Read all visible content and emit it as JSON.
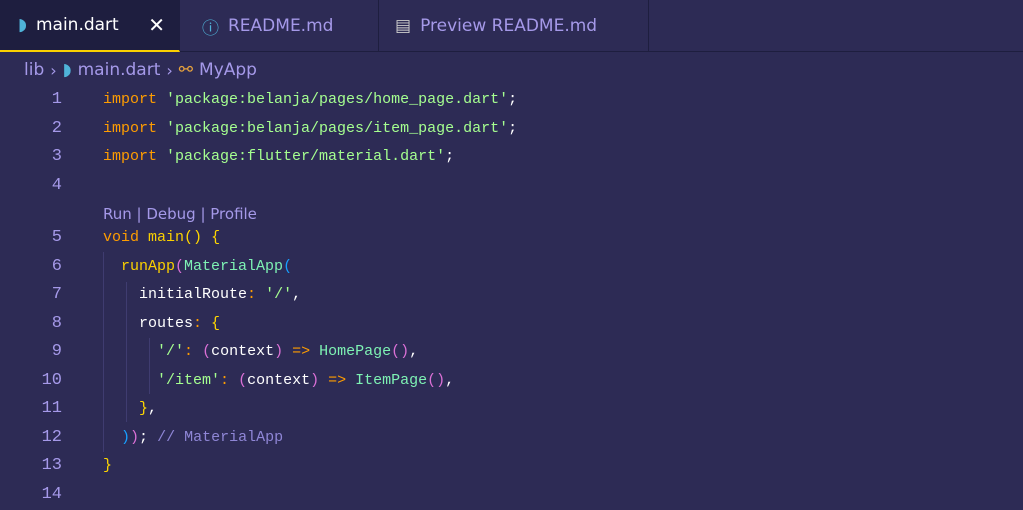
{
  "tabs": [
    {
      "label": "main.dart",
      "icon": "dart-icon",
      "active": true
    },
    {
      "label": "README.md",
      "icon": "info-icon"
    },
    {
      "label": "Preview README.md",
      "icon": "preview-icon"
    }
  ],
  "close_label": "✕",
  "breadcrumb": {
    "items": [
      "lib",
      "main.dart",
      "MyApp"
    ]
  },
  "codelens": "Run | Debug | Profile",
  "lines": [
    {
      "n": "1",
      "t": [
        [
          "import",
          "kw"
        ],
        [
          " ",
          "tx"
        ],
        [
          "'package:belanja/pages/home_page.dart'",
          "str"
        ],
        [
          ";",
          "tx"
        ]
      ]
    },
    {
      "n": "2",
      "t": [
        [
          "import",
          "kw"
        ],
        [
          " ",
          "tx"
        ],
        [
          "'package:belanja/pages/item_page.dart'",
          "str"
        ],
        [
          ";",
          "tx"
        ]
      ]
    },
    {
      "n": "3",
      "t": [
        [
          "import",
          "kw"
        ],
        [
          " ",
          "tx"
        ],
        [
          "'package:flutter/material.dart'",
          "str"
        ],
        [
          ";",
          "tx"
        ]
      ]
    },
    {
      "n": "4",
      "t": []
    },
    {
      "n": "5",
      "t": [
        [
          "void",
          "kw"
        ],
        [
          " ",
          "tx"
        ],
        [
          "main",
          "fn"
        ],
        [
          "()",
          "p1"
        ],
        [
          " ",
          "tx"
        ],
        [
          "{",
          "p1"
        ]
      ]
    },
    {
      "n": "6",
      "t": [
        [
          "  ",
          "tx"
        ],
        [
          "runApp",
          "fn"
        ],
        [
          "(",
          "p2"
        ],
        [
          "MaterialApp",
          "cls"
        ],
        [
          "(",
          "p3"
        ]
      ]
    },
    {
      "n": "7",
      "t": [
        [
          "    initialRoute",
          "tx"
        ],
        [
          ":",
          "op"
        ],
        [
          " ",
          "tx"
        ],
        [
          "'/'",
          "str"
        ],
        [
          ",",
          "tx"
        ]
      ]
    },
    {
      "n": "8",
      "t": [
        [
          "    routes",
          "tx"
        ],
        [
          ":",
          "op"
        ],
        [
          " ",
          "tx"
        ],
        [
          "{",
          "p1"
        ]
      ]
    },
    {
      "n": "9",
      "t": [
        [
          "      ",
          "tx"
        ],
        [
          "'/'",
          "str"
        ],
        [
          ":",
          "op"
        ],
        [
          " ",
          "tx"
        ],
        [
          "(",
          "p2"
        ],
        [
          "context",
          "tx"
        ],
        [
          ")",
          "p2"
        ],
        [
          " ",
          "tx"
        ],
        [
          "=>",
          "op"
        ],
        [
          " ",
          "tx"
        ],
        [
          "HomePage",
          "cls"
        ],
        [
          "()",
          "p2"
        ],
        [
          ",",
          "tx"
        ]
      ]
    },
    {
      "n": "10",
      "t": [
        [
          "      ",
          "tx"
        ],
        [
          "'/item'",
          "str"
        ],
        [
          ":",
          "op"
        ],
        [
          " ",
          "tx"
        ],
        [
          "(",
          "p2"
        ],
        [
          "context",
          "tx"
        ],
        [
          ")",
          "p2"
        ],
        [
          " ",
          "tx"
        ],
        [
          "=>",
          "op"
        ],
        [
          " ",
          "tx"
        ],
        [
          "ItemPage",
          "cls"
        ],
        [
          "()",
          "p2"
        ],
        [
          ",",
          "tx"
        ]
      ]
    },
    {
      "n": "11",
      "t": [
        [
          "    ",
          "tx"
        ],
        [
          "}",
          "p1"
        ],
        [
          ",",
          "tx"
        ]
      ]
    },
    {
      "n": "12",
      "t": [
        [
          "  ",
          "tx"
        ],
        [
          ")",
          "p3"
        ],
        [
          ")",
          "p2"
        ],
        [
          ";",
          "tx"
        ],
        [
          " ",
          "tx"
        ],
        [
          "// MaterialApp",
          "cm"
        ]
      ]
    },
    {
      "n": "13",
      "t": [
        [
          "}",
          "p1"
        ]
      ]
    },
    {
      "n": "14",
      "t": []
    }
  ]
}
